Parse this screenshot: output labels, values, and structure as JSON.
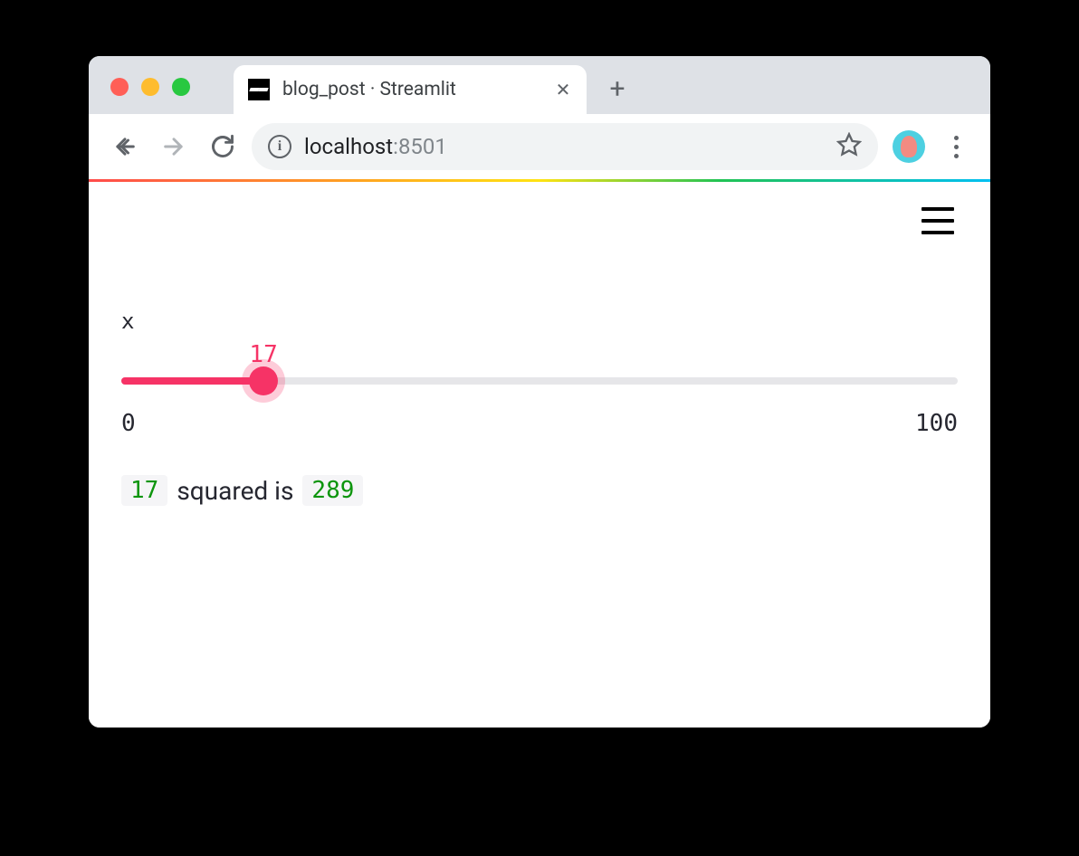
{
  "browser": {
    "tab_title": "blog_post · Streamlit",
    "url_host": "localhost",
    "url_port": ":8501"
  },
  "app": {
    "slider": {
      "label": "x",
      "value": 17,
      "min": 0,
      "max": 100
    },
    "result": {
      "x": 17,
      "text": "squared is",
      "xsq": 289
    }
  },
  "colors": {
    "accent": "#f63366",
    "code_green": "#0d950d"
  }
}
